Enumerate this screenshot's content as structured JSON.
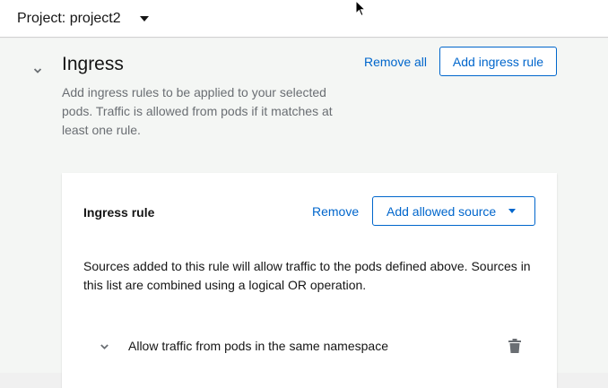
{
  "header": {
    "project_label": "Project: project2"
  },
  "ingress": {
    "title": "Ingress",
    "description": "Add ingress rules to be applied to your selected pods. Traffic is allowed from pods if it matches at least one rule.",
    "remove_all_label": "Remove all",
    "add_rule_label": "Add ingress rule"
  },
  "rule": {
    "title": "Ingress rule",
    "remove_label": "Remove",
    "add_source_label": "Add allowed source",
    "description": "Sources added to this rule will allow traffic to the pods defined above. Sources in this list are combined using a logical OR operation.",
    "sources": [
      {
        "label": "Allow traffic from pods in the same namespace"
      }
    ]
  },
  "colors": {
    "link": "#0066cc",
    "muted_text": "#6a6e73",
    "page_bg": "#f4f6f4"
  }
}
